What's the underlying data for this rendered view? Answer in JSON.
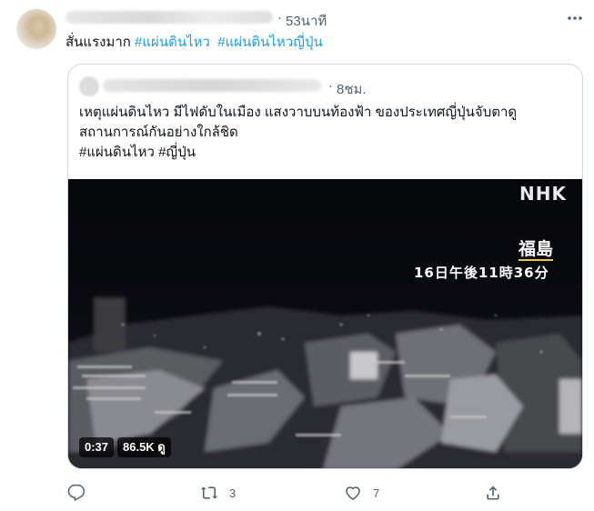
{
  "tweet": {
    "time": "53นาที",
    "separator": "·",
    "text_prefix": "สั่นแรงมาก ",
    "hashtags": [
      "#แผ่นดินไหว",
      "#แผ่นดินไหวญี่ปุ่น"
    ]
  },
  "quoted": {
    "separator": "·",
    "time": "8ชม.",
    "lines": [
      "เหตุแผ่นดินไหว มีไฟดับในเมือง แสงวาบบนท้องฟ้า ของประเทศญี่ปุ่นจับตาดู",
      "สถานการณ์กันอย่างใกล้ชิด",
      "#แผ่นดินไหว #ญี่ปุ่น"
    ],
    "video": {
      "logo": "NHK",
      "location": "福島",
      "datetime": "16日午後11時36分",
      "duration": "0:37",
      "views": "86.5K ดู"
    }
  },
  "actions": {
    "reply_count": "",
    "retweet_count": "3",
    "like_count": "7"
  },
  "icons": [
    "more-icon",
    "reply-icon",
    "retweet-icon",
    "like-icon",
    "share-icon"
  ],
  "colors": {
    "link": "#1d9bf0",
    "muted": "#536471",
    "border": "#cfd9de"
  }
}
